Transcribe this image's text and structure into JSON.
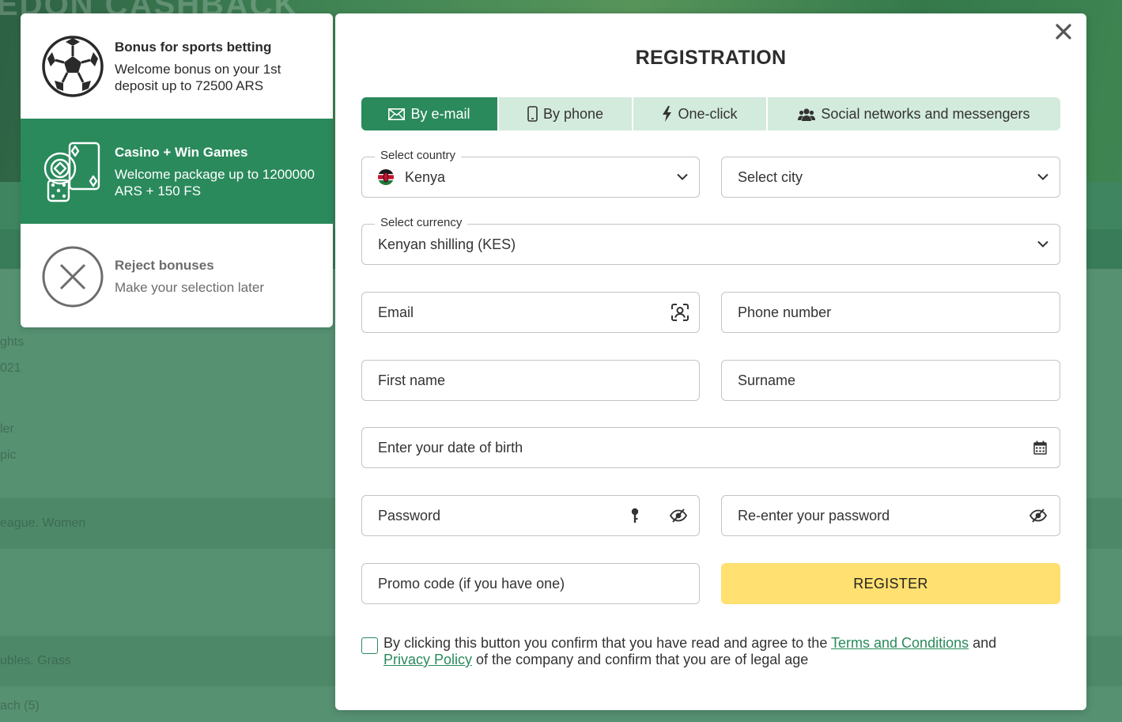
{
  "background": {
    "banner_text": "EDON CASHBACK",
    "rows": [
      "ghts",
      "021",
      "ler",
      "pic",
      "eague. Women",
      "ubles. Grass",
      "ach (5)"
    ]
  },
  "bonus_panel": {
    "items": [
      {
        "title": "Bonus for sports betting",
        "desc": "Welcome bonus on your 1st deposit up to 72500 ARS",
        "icon": "soccer-ball-icon"
      },
      {
        "title": "Casino + Win Games",
        "desc": "Welcome package up to 1200000 ARS + 150 FS",
        "icon": "casino-cards-dice-icon"
      },
      {
        "title": "Reject bonuses",
        "desc": "Make your selection later",
        "icon": "reject-x-icon"
      }
    ],
    "selected_index": 1
  },
  "registration": {
    "title": "REGISTRATION",
    "tabs": [
      {
        "label": "By e-mail",
        "icon": "envelope-icon",
        "active": true
      },
      {
        "label": "By phone",
        "icon": "phone-icon",
        "active": false
      },
      {
        "label": "One-click",
        "icon": "lightning-icon",
        "active": false
      },
      {
        "label": "Social networks and messengers",
        "icon": "users-icon",
        "active": false
      }
    ],
    "country": {
      "label": "Select country",
      "value": "Kenya"
    },
    "city": {
      "placeholder": "Select city"
    },
    "currency": {
      "label": "Select currency",
      "value": "Kenyan shilling (KES)"
    },
    "email": {
      "placeholder": "Email"
    },
    "phone": {
      "placeholder": "Phone number"
    },
    "first_name": {
      "placeholder": "First name"
    },
    "surname": {
      "placeholder": "Surname"
    },
    "dob": {
      "placeholder": "Enter your date of birth"
    },
    "password": {
      "placeholder": "Password"
    },
    "password_repeat": {
      "placeholder": "Re-enter your password"
    },
    "promo": {
      "placeholder": "Promo code (if you have one)"
    },
    "register_label": "REGISTER",
    "consent": {
      "before": "By clicking this button you confirm that you have read and agree to the ",
      "terms_link": "Terms and Conditions",
      "middle": " and ",
      "privacy_link": "Privacy Policy",
      "after": " of the company and confirm that you are of legal age",
      "checked": false
    }
  },
  "colors": {
    "accent_green": "#2a8a5c",
    "tab_inactive": "#d3ebdd",
    "register_yellow": "#ffe070",
    "link_green": "#2a8a5c"
  }
}
